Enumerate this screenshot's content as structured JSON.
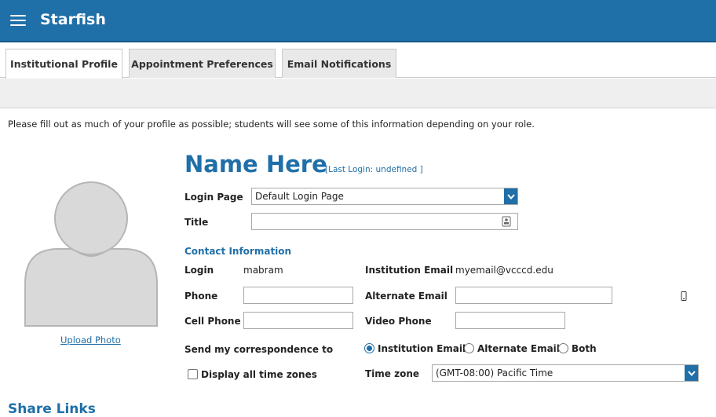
{
  "app": {
    "title": "Starfish"
  },
  "tabs": [
    "Institutional Profile",
    "Appointment Preferences",
    "Email Notifications"
  ],
  "intro": "Please fill out as much of your profile as possible; students will see some of this information depending on your role.",
  "profile": {
    "name": "Name Here",
    "last_login": "[Last Login: undefined ]",
    "upload_photo": "Upload Photo"
  },
  "form": {
    "login_page_label": "Login Page",
    "login_page_value": "Default Login Page",
    "title_label": "Title",
    "title_value": ""
  },
  "contact": {
    "heading": "Contact Information",
    "login_label": "Login",
    "login_value": "mabram",
    "institution_email_label": "Institution Email",
    "institution_email_value": "myemail@vcccd.edu",
    "phone_label": "Phone",
    "phone_value": "",
    "alternate_email_label": "Alternate Email",
    "alternate_email_value": "",
    "cell_phone_label": "Cell Phone",
    "cell_phone_value": "",
    "video_phone_label": "Video Phone",
    "video_phone_value": "",
    "correspondence_label": "Send my correspondence to",
    "correspondence_options": [
      "Institution Email",
      "Alternate Email",
      "Both"
    ],
    "correspondence_selected": "Institution Email",
    "display_timezones_label": "Display all time zones",
    "timezone_label": "Time zone",
    "timezone_value": "(GMT-08:00) Pacific Time"
  },
  "share_links": {
    "heading": "Share Links"
  },
  "colors": {
    "primary": "#1f6fa8",
    "tab_inactive": "#e9e9e9",
    "bar": "#efefef"
  }
}
